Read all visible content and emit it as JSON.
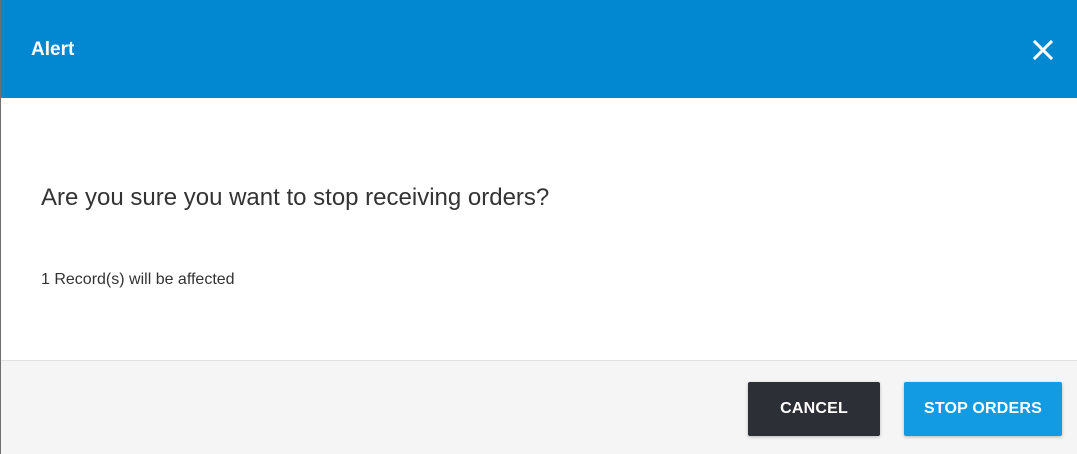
{
  "dialog": {
    "title": "Alert",
    "close_icon": "close-icon",
    "message": "Are you sure you want to stop receiving orders?",
    "detail": "1 Record(s) will be affected",
    "cancel_label": "CANCEL",
    "confirm_label": "STOP ORDERS"
  },
  "colors": {
    "header": "#0288d1",
    "cancel_button": "#2c2f36",
    "confirm_button": "#129be3",
    "footer": "#f5f5f5"
  }
}
